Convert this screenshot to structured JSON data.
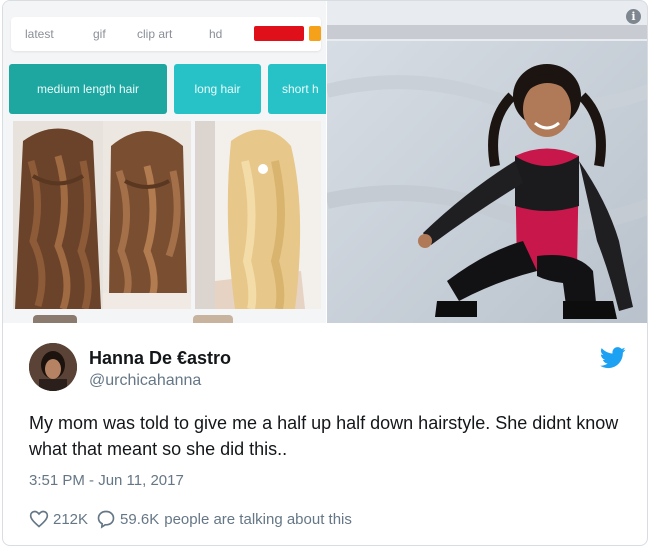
{
  "filters": [
    "latest",
    "gif",
    "clip art",
    "hd"
  ],
  "tags": [
    "medium length hair",
    "long hair",
    "short h"
  ],
  "info_icon": "i",
  "tweet": {
    "name": "Hanna De €astro",
    "handle": "@urchicahanna",
    "text": "My mom was told to give me a half up half down hairstyle. She didnt know what that meant so she did this..",
    "timestamp": "3:51 PM - Jun 11, 2017",
    "likes": "212K",
    "replies": "59.6K",
    "talking": "people are talking about this"
  },
  "icons": {
    "like": "heart-icon",
    "reply": "speech-bubble-icon",
    "brand": "twitter-bird-icon",
    "info": "info-icon"
  },
  "colors": {
    "twitter_blue": "#1da1f2",
    "tag_teal_dark": "#1ea7a0",
    "tag_teal": "#27c2c7",
    "muted_text": "#657786"
  }
}
